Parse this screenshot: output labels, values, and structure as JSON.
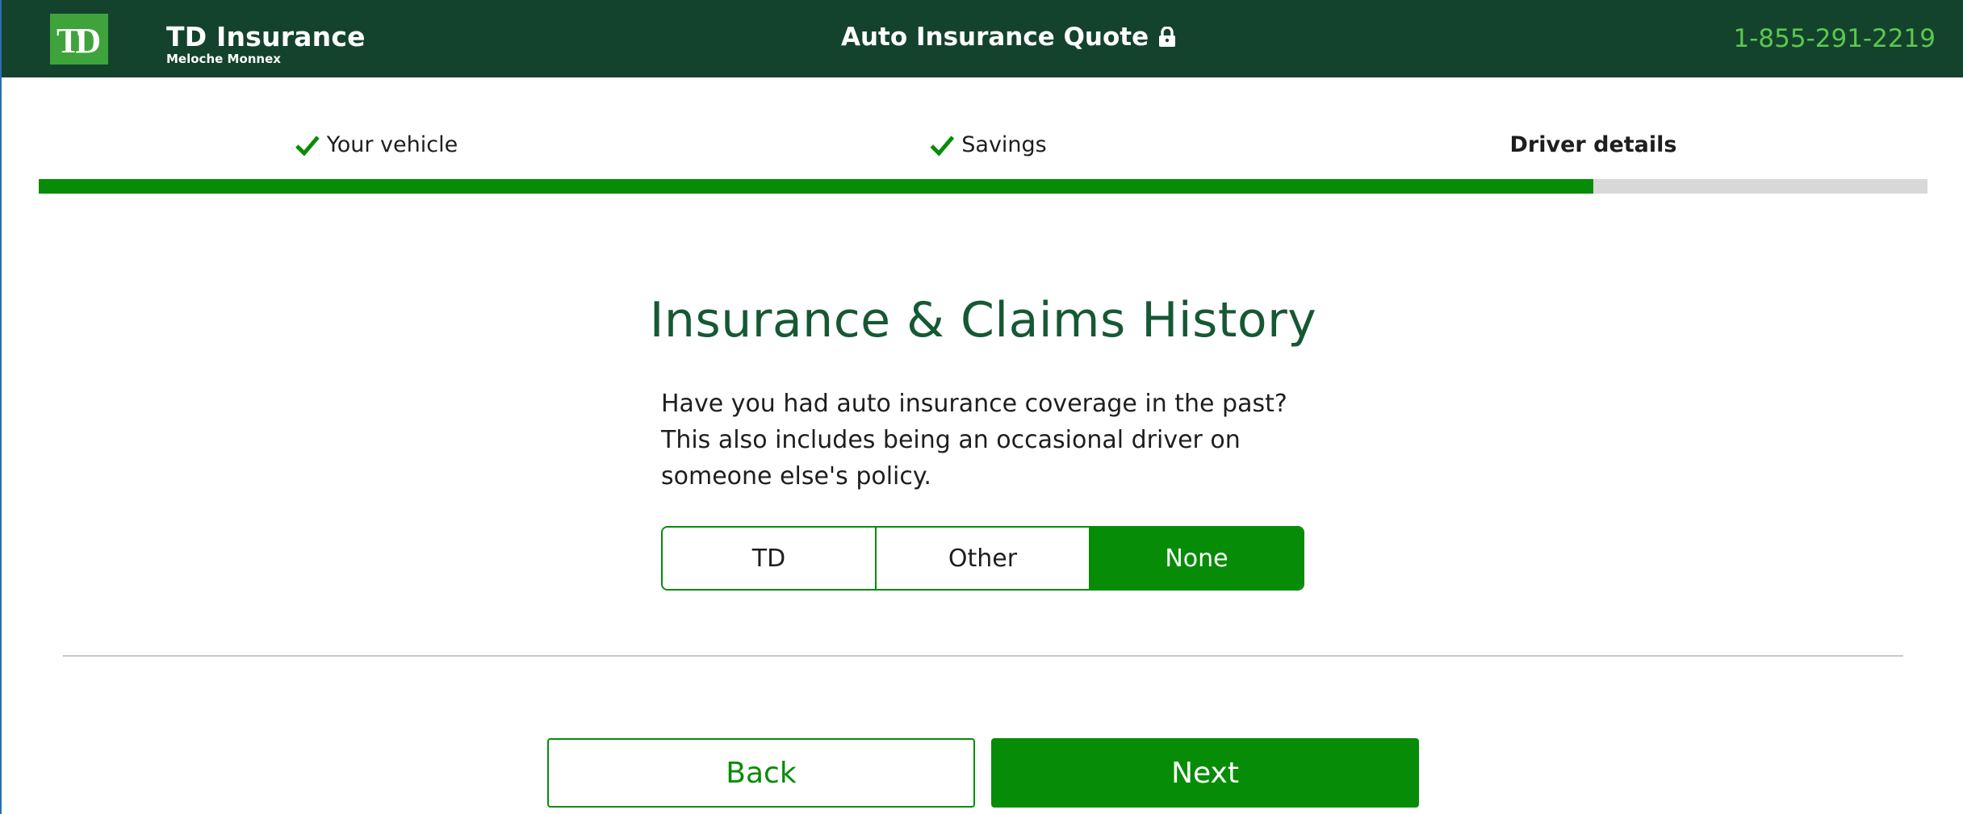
{
  "header": {
    "logo_text": "TD",
    "brand_name": "TD Insurance",
    "brand_sub": "Meloche Monnex",
    "title": "Auto Insurance Quote",
    "phone": "1-855-291-2219",
    "lock_icon": "lock-icon"
  },
  "steps": [
    {
      "label": "Your vehicle",
      "status": "complete",
      "icon": "checkmark-icon"
    },
    {
      "label": "Savings",
      "status": "complete",
      "icon": "checkmark-icon"
    },
    {
      "label": "Driver details",
      "status": "current"
    }
  ],
  "progress": {
    "percent": 82.3
  },
  "main": {
    "heading": "Insurance & Claims History",
    "question": "Have you had auto insurance coverage in the past? This also includes being an occasional driver on someone else's policy.",
    "options": [
      {
        "label": "TD",
        "selected": false
      },
      {
        "label": "Other",
        "selected": false
      },
      {
        "label": "None",
        "selected": true
      }
    ]
  },
  "actions": {
    "back_label": "Back",
    "next_label": "Next"
  },
  "colors": {
    "header_bg": "#14432d",
    "accent": "#078c08",
    "logo_green": "#3ea33b",
    "phone": "#5bc84e"
  }
}
